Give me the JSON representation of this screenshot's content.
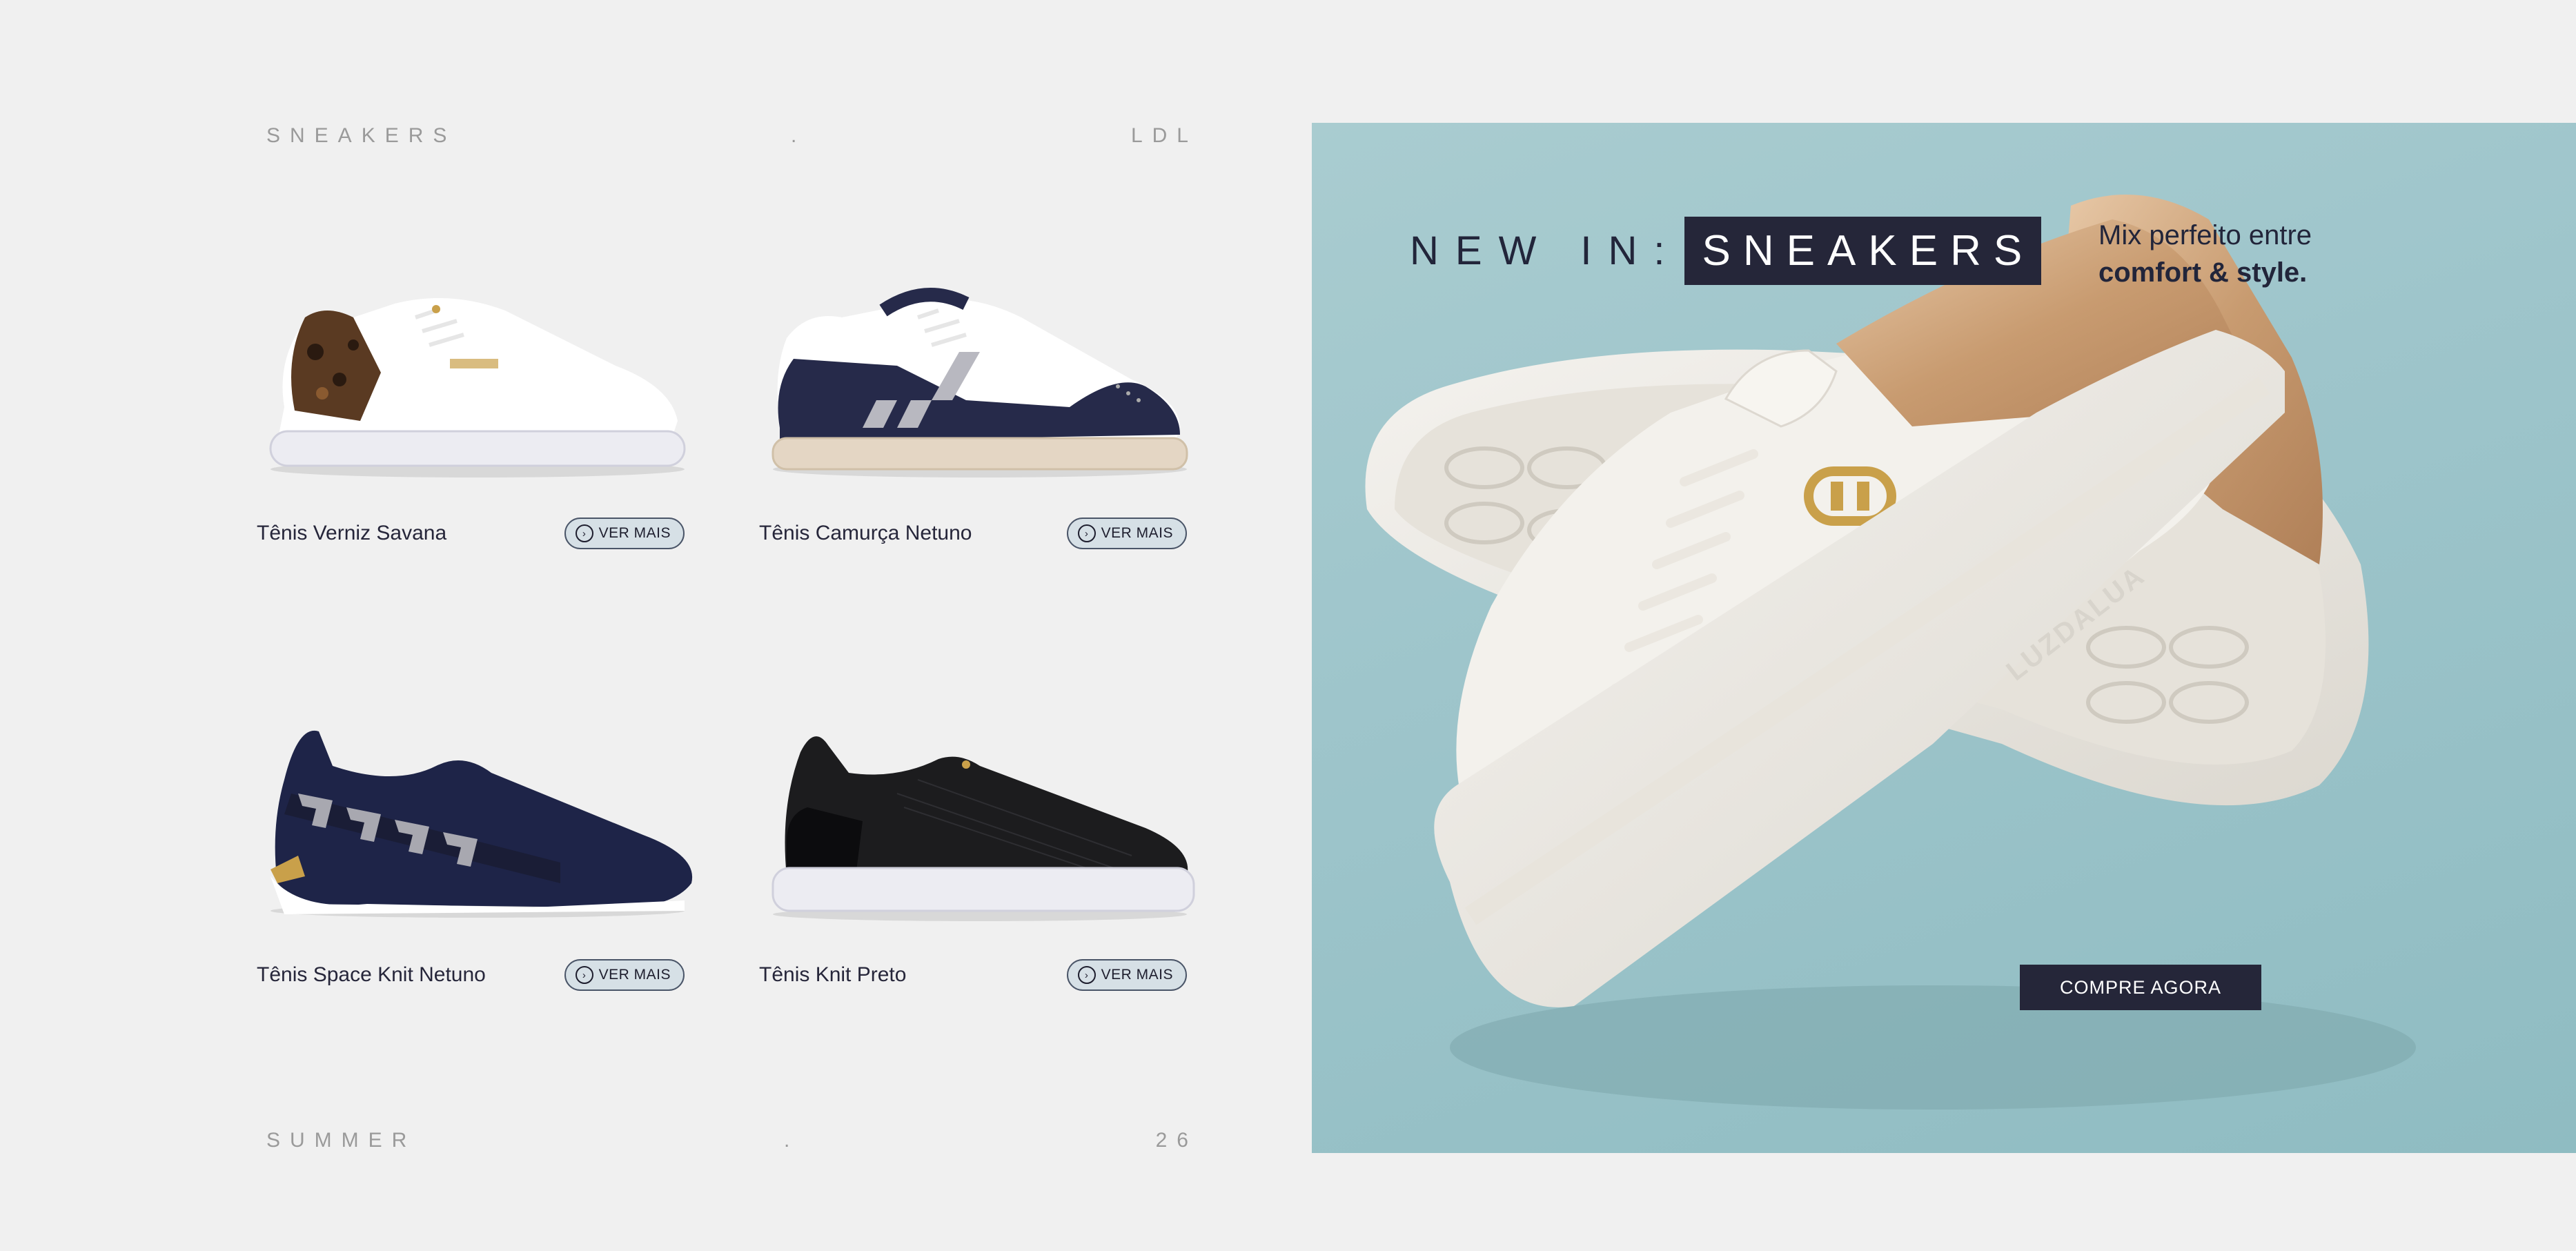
{
  "header": {
    "left": "SNEAKERS",
    "separator": ".",
    "right": "LDL"
  },
  "footer": {
    "left": "SUMMER",
    "separator": ".",
    "right": "26"
  },
  "products": [
    {
      "name": "Tênis Verniz Savana",
      "button": "VER MAIS"
    },
    {
      "name": "Tênis Camurça Netuno",
      "button": "VER MAIS"
    },
    {
      "name": "Tênis Space Knit Netuno",
      "button": "VER MAIS"
    },
    {
      "name": "Tênis Knit Preto",
      "button": "VER MAIS"
    }
  ],
  "hero": {
    "prefix": "NEW IN:",
    "badge": "SNEAKERS",
    "tagline_line1": "Mix perfeito entre",
    "tagline_line2": "comfort & style.",
    "cta": "COMPRE AGORA",
    "brand_mark": "LUZDALUA",
    "small_brand": "LUZDALUA"
  },
  "colors": {
    "background": "#f0f0f0",
    "hero_bg": "#9ec5cb",
    "dark_navy": "#252639",
    "button_bg": "#d6e0e6"
  },
  "icons": [
    "arrow-circle-icon"
  ]
}
